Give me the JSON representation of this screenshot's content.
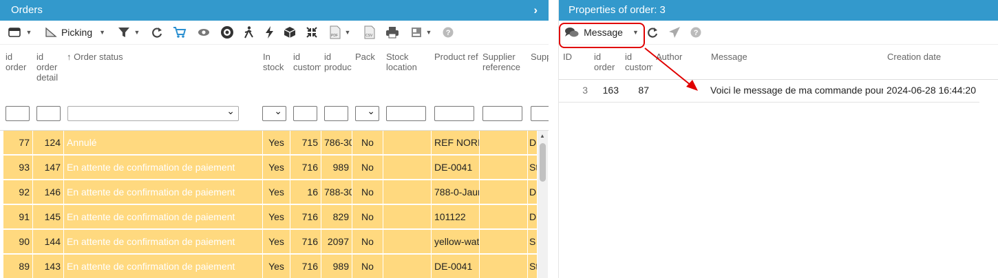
{
  "orders_panel": {
    "title": "Orders",
    "toolbar": {
      "picking_label": "Picking"
    },
    "columns": [
      {
        "key": "id_order",
        "label": "id order"
      },
      {
        "key": "id_order_detail",
        "label": "id order detail"
      },
      {
        "key": "order_status",
        "label": "Order status"
      },
      {
        "key": "in_stock",
        "label": "In stock"
      },
      {
        "key": "id_customer",
        "label": "id customer"
      },
      {
        "key": "id_product",
        "label": "id product"
      },
      {
        "key": "pack",
        "label": "Pack"
      },
      {
        "key": "stock_location",
        "label": "Stock location"
      },
      {
        "key": "product_ref",
        "label": "Product ref"
      },
      {
        "key": "supplier_reference",
        "label": "Supplier reference"
      },
      {
        "key": "supplier",
        "label": "Supp"
      }
    ],
    "rows": [
      [
        "77",
        "124",
        "Annulé",
        "Yes",
        "715",
        "786-30",
        "No",
        "",
        "REF NORI",
        "",
        "D"
      ],
      [
        "93",
        "147",
        "En attente de confirmation de paiement",
        "Yes",
        "716",
        "989",
        "No",
        "",
        "DE-0041",
        "",
        "St"
      ],
      [
        "92",
        "146",
        "En attente de confirmation de paiement",
        "Yes",
        "16",
        "788-30",
        "No",
        "",
        "788-0-Jaur",
        "",
        "D"
      ],
      [
        "91",
        "145",
        "En attente de confirmation de paiement",
        "Yes",
        "716",
        "829",
        "No",
        "",
        "101122",
        "",
        "D"
      ],
      [
        "90",
        "144",
        "En attente de confirmation de paiement",
        "Yes",
        "716",
        "2097",
        "No",
        "",
        "yellow-wat",
        "",
        "S"
      ],
      [
        "89",
        "143",
        "En attente de confirmation de paiement",
        "Yes",
        "716",
        "989",
        "No",
        "",
        "DE-0041",
        "",
        "St"
      ]
    ],
    "row_color": "#ffd97f"
  },
  "properties_panel": {
    "title": "Properties of order: 3",
    "toolbar": {
      "message_label": "Message"
    },
    "columns": [
      {
        "key": "id",
        "label": "ID"
      },
      {
        "key": "id_order",
        "label": "id order"
      },
      {
        "key": "id_customer",
        "label": "id customer"
      },
      {
        "key": "author",
        "label": "Author"
      },
      {
        "key": "message",
        "label": "Message"
      },
      {
        "key": "creation_date",
        "label": "Creation date"
      }
    ],
    "rows": [
      [
        "3",
        "163",
        "87",
        "",
        "Voici le message de ma commande pour",
        "2024-06-28 16:44:20"
      ]
    ]
  },
  "colors": {
    "header_blue": "#3399cc",
    "highlight_red": "#e00000"
  }
}
